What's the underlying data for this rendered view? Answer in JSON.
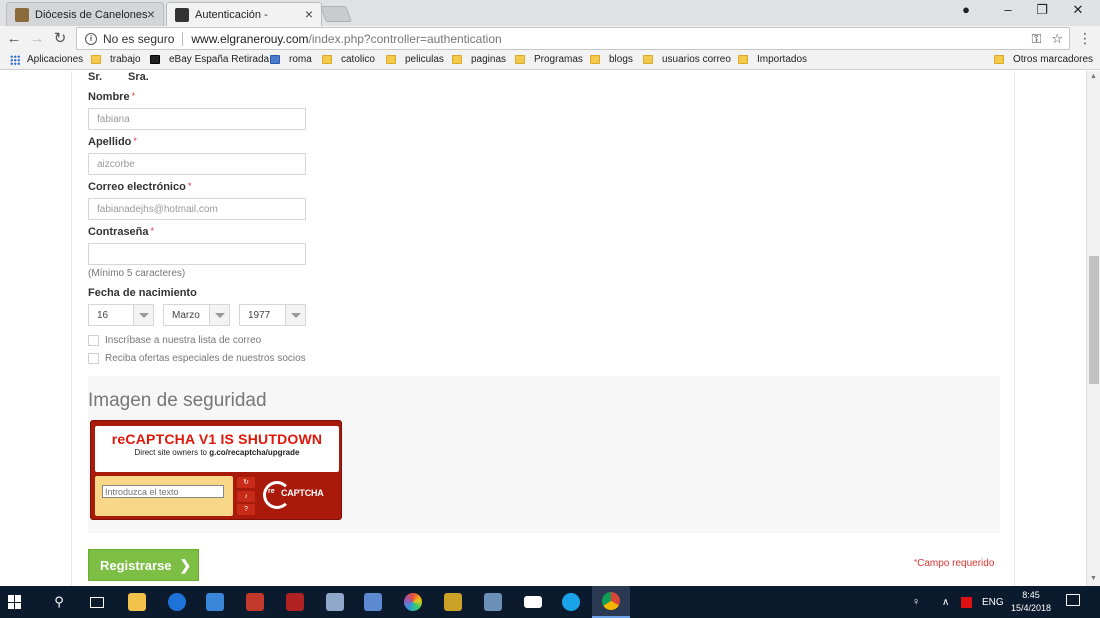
{
  "browser": {
    "tabs": [
      {
        "title": "Diócesis de Canelones",
        "active": false
      },
      {
        "title": "Autenticación -",
        "active": true
      }
    ],
    "security_label": "No es seguro",
    "url_host": "www.elgranerouy.com",
    "url_path": "/index.php?controller=authentication",
    "bookmarks": [
      "Aplicaciones",
      "trabajo",
      "eBay España Retirada",
      "roma",
      "catolico",
      "peliculas",
      "paginas",
      "Programas",
      "blogs",
      "usuarios correo",
      "Importados",
      "Otros marcadores"
    ]
  },
  "form": {
    "title_options": [
      "Sr.",
      "Sra."
    ],
    "nombre_label": "Nombre",
    "nombre_value": "fabiana",
    "apellido_label": "Apellido",
    "apellido_value": "aizcorbe",
    "email_label": "Correo electrónico",
    "email_value": "fabianadejhs@hotmail.com",
    "password_label": "Contraseña",
    "password_value": "",
    "password_hint": "(Mínimo 5 caracteres)",
    "birth_label": "Fecha de nacimiento",
    "birth_day": "16",
    "birth_month": "Marzo",
    "birth_year": "1977",
    "newsletter_label": "Inscríbase a nuestra lista de correo",
    "offers_label": "Reciba ofertas especiales de nuestros socios",
    "required_mark": "*"
  },
  "security": {
    "title": "Imagen de seguridad",
    "captcha_headline": "reCAPTCHA V1 IS SHUTDOWN",
    "captcha_sub_prefix": "Direct site owners to ",
    "captcha_sub_link": "g.co/recaptcha/upgrade",
    "captcha_placeholder": "Introduzca el texto",
    "captcha_logo_re": "re",
    "captcha_logo_word": "CAPTCHA"
  },
  "actions": {
    "register_label": "Registrarse",
    "required_note": "Campo requerido"
  },
  "taskbar": {
    "lang": "ENG",
    "time": "8:45",
    "date": "15/4/2018"
  },
  "colors": {
    "accent_green": "#7dbf44",
    "captcha_red": "#a91a0a",
    "required_red": "#d33333",
    "taskbar_bg": "#0c1a2e"
  }
}
